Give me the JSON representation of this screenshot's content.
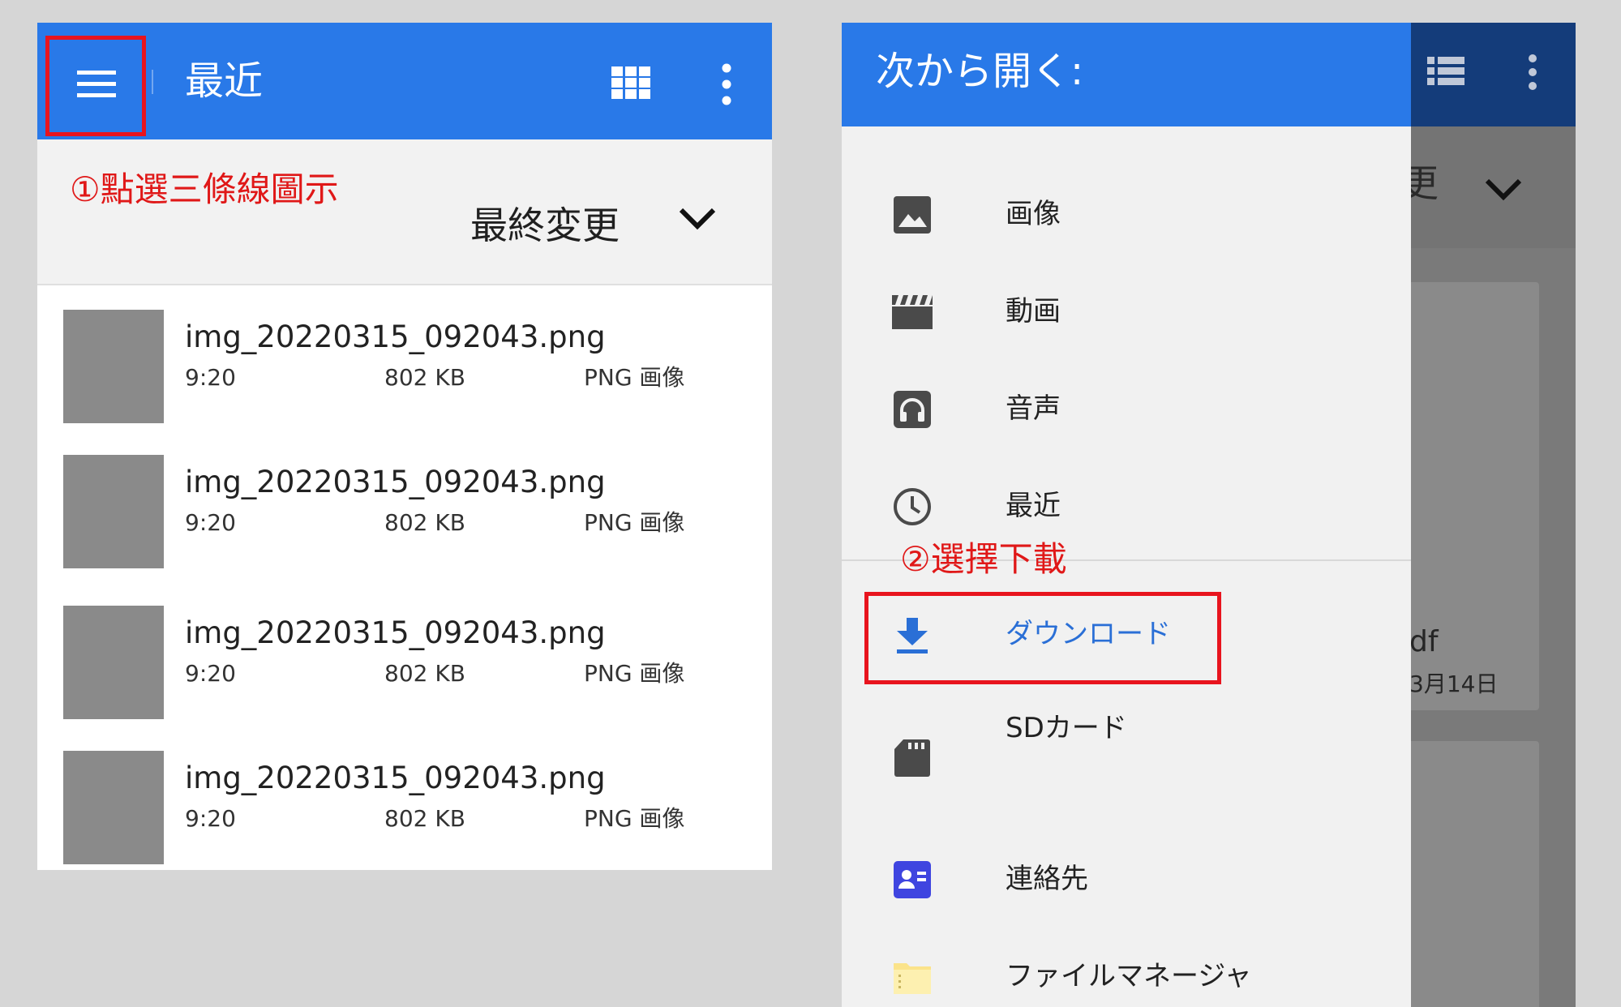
{
  "left": {
    "appbar": {
      "title": "最近",
      "menu_icon": "hamburger-menu-icon",
      "grid_icon": "grid-view-icon",
      "more_icon": "more-vert-icon",
      "color": "#2979e8"
    },
    "annotation": "①點選三條線圖示",
    "sort": {
      "label": "最終変更",
      "chevron_icon": "chevron-down-icon"
    },
    "files": [
      {
        "name": "img_20220315_092043.png",
        "time": "9:20",
        "size": "802 KB",
        "type": "PNG 画像"
      },
      {
        "name": "img_20220315_092043.png",
        "time": "9:20",
        "size": "802 KB",
        "type": "PNG 画像"
      },
      {
        "name": "img_20220315_092043.png",
        "time": "9:20",
        "size": "802 KB",
        "type": "PNG 画像"
      },
      {
        "name": "img_20220315_092043.png",
        "time": "9:20",
        "size": "802 KB",
        "type": "PNG 画像"
      }
    ]
  },
  "right": {
    "drawer_title": "次から開く:",
    "annotation": "②選擇下載",
    "items": [
      {
        "label": "画像",
        "icon": "image-icon"
      },
      {
        "label": "動画",
        "icon": "video-clapper-icon"
      },
      {
        "label": "音声",
        "icon": "headphones-icon"
      },
      {
        "label": "最近",
        "icon": "clock-icon"
      },
      {
        "label": "ダウンロード",
        "icon": "download-icon"
      },
      {
        "label": "SDカード",
        "icon": "sd-card-icon"
      },
      {
        "label": "連絡先",
        "icon": "contacts-icon"
      },
      {
        "label": "ファイルマネージャ",
        "icon": "folder-icon"
      }
    ],
    "background": {
      "list_icon": "list-view-icon",
      "more_icon": "more-vert-icon",
      "chevron_icon": "chevron-down-icon",
      "sort_fragment": "更",
      "file_fragment": "df",
      "date_fragment": "3月14日"
    },
    "accent": "#2a6fd6",
    "highlight": "#e8141e"
  }
}
